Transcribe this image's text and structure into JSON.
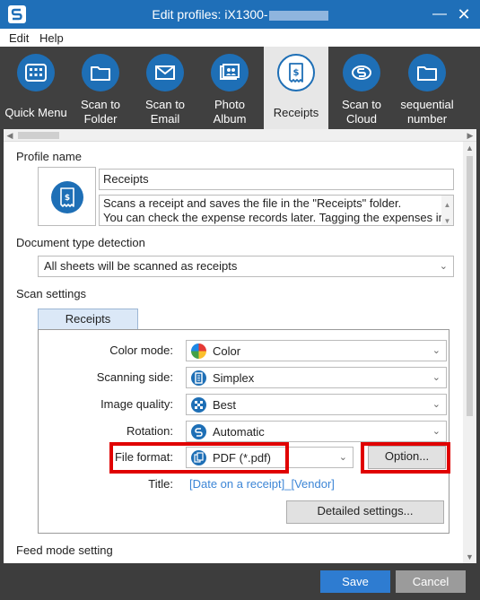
{
  "window": {
    "title": "Edit profiles: iX1300-",
    "minimize_glyph": "—",
    "close_glyph": "✕"
  },
  "menu": {
    "edit": "Edit",
    "help": "Help"
  },
  "toolbar": {
    "items": [
      {
        "label": "Quick Menu",
        "icon": "grid-icon"
      },
      {
        "label": "Scan to Folder",
        "line1": "Scan to",
        "line2": "Folder",
        "icon": "folder-icon"
      },
      {
        "label": "Scan to Email",
        "line1": "Scan to",
        "line2": "Email",
        "icon": "envelope-icon"
      },
      {
        "label": "Photo Album",
        "line1": "Photo",
        "line2": "Album",
        "icon": "photo-album-icon"
      },
      {
        "label": "Receipts",
        "icon": "receipt-icon",
        "selected": true
      },
      {
        "label": "Scan to Cloud",
        "line1": "Scan to",
        "line2": "Cloud",
        "icon": "cloud-icon"
      },
      {
        "label": "sequential number",
        "line1": "sequential",
        "line2": "number",
        "icon": "folder-icon"
      }
    ]
  },
  "profile": {
    "section_label": "Profile name",
    "name": "Receipts",
    "description_line1": "Scans a receipt and saves the file in the \"Receipts\" folder.",
    "description_line2": "You can check the expense records later. Tagging the expenses in"
  },
  "doc_detect": {
    "label": "Document type detection",
    "value": "All sheets will be scanned as receipts"
  },
  "scan_settings": {
    "label": "Scan settings",
    "tab": "Receipts",
    "rows": {
      "color_mode": {
        "label": "Color mode:",
        "value": "Color"
      },
      "scanning_side": {
        "label": "Scanning side:",
        "value": "Simplex"
      },
      "image_quality": {
        "label": "Image quality:",
        "value": "Best"
      },
      "rotation": {
        "label": "Rotation:",
        "value": "Automatic"
      },
      "file_format": {
        "label": "File format:",
        "value": "PDF (*.pdf)"
      }
    },
    "option_button": "Option...",
    "title_label": "Title:",
    "title_value": "[Date on a receipt]_[Vendor]",
    "detailed_button": "Detailed settings..."
  },
  "feed_mode": {
    "label": "Feed mode setting"
  },
  "footer": {
    "save": "Save",
    "cancel": "Cancel"
  },
  "colors": {
    "titlebar": "#1f6fb8",
    "accent": "#1e6fb6",
    "highlight_box": "#e00000",
    "toolbar_bg": "#404040",
    "link": "#3d86d6"
  }
}
